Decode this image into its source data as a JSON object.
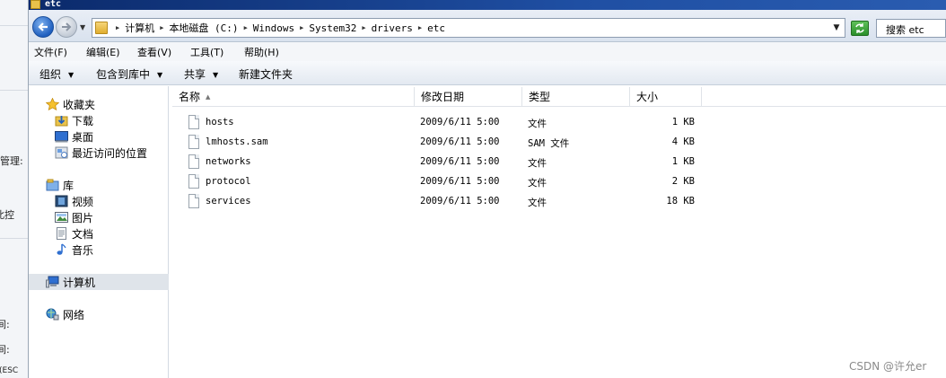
{
  "background_window": {
    "labels": [
      "管理:",
      "此控",
      "间:",
      "间:",
      "(ESC"
    ]
  },
  "window": {
    "title": "etc"
  },
  "address": {
    "breadcrumb": [
      "计算机",
      "本地磁盘 (C:)",
      "Windows",
      "System32",
      "drivers",
      "etc"
    ],
    "search_text": "搜索 etc"
  },
  "menu": {
    "items": [
      "文件(F)",
      "编辑(E)",
      "查看(V)",
      "工具(T)",
      "帮助(H)"
    ]
  },
  "toolbar": {
    "organize": "组织",
    "include_in_library": "包含到库中",
    "share": "共享",
    "new_folder": "新建文件夹"
  },
  "nav": {
    "favorites": "收藏夹",
    "downloads": "下载",
    "desktop": "桌面",
    "recent": "最近访问的位置",
    "libraries": "库",
    "videos": "视频",
    "pictures": "图片",
    "documents": "文档",
    "music": "音乐",
    "computer": "计算机",
    "network": "网络"
  },
  "columns": [
    "名称",
    "修改日期",
    "类型",
    "大小"
  ],
  "files": [
    {
      "name": "hosts",
      "date": "2009/6/11 5:00",
      "type": "文件",
      "size": "1 KB"
    },
    {
      "name": "lmhosts.sam",
      "date": "2009/6/11 5:00",
      "type": "SAM 文件",
      "size": "4 KB"
    },
    {
      "name": "networks",
      "date": "2009/6/11 5:00",
      "type": "文件",
      "size": "1 KB"
    },
    {
      "name": "protocol",
      "date": "2009/6/11 5:00",
      "type": "文件",
      "size": "2 KB"
    },
    {
      "name": "services",
      "date": "2009/6/11 5:00",
      "type": "文件",
      "size": "18 KB"
    }
  ],
  "watermark": "CSDN @许允er"
}
